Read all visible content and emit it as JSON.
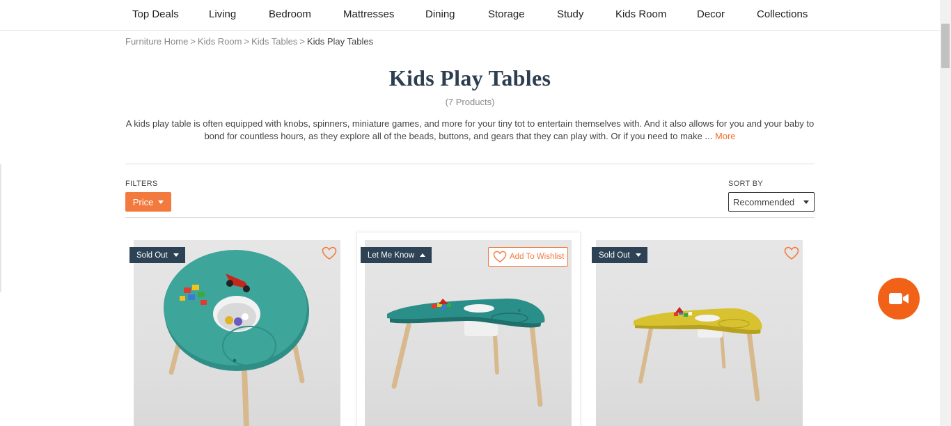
{
  "nav": {
    "items": [
      "Top Deals",
      "Living",
      "Bedroom",
      "Mattresses",
      "Dining",
      "Storage",
      "Study",
      "Kids Room",
      "Decor",
      "Collections"
    ]
  },
  "breadcrumb": {
    "items": [
      "Furniture Home",
      "Kids Room",
      "Kids Tables"
    ],
    "separator": ">",
    "current": "Kids Play Tables"
  },
  "page": {
    "title": "Kids Play Tables",
    "count": "(7 Products)",
    "description": "A kids play table is often equipped with knobs, spinners, miniature games, and more for your tiny tot to entertain themselves with. And it also allows for you and your baby to bond for countless hours, as they explore all of the beads, buttons, and gears that they can play with. Or if you need to make ...",
    "more_label": "More"
  },
  "filters": {
    "label": "FILTERS",
    "price_label": "Price"
  },
  "sort": {
    "label": "SORT BY",
    "selected": "Recommended"
  },
  "products": [
    {
      "badge": "Sold Out",
      "table_color": "#3ea59b",
      "wishlisted": false
    },
    {
      "badge": "Let Me Know",
      "table_color": "#2a8f89",
      "wishlist_label": "Add To Wishlist"
    },
    {
      "badge": "Sold Out",
      "table_color": "#d8c230",
      "wishlisted": false
    }
  ],
  "colors": {
    "accent": "#f37a3f",
    "badge_bg": "#2d4355",
    "title": "#2d3e50",
    "video_button": "#f26118"
  },
  "icons": {
    "heart": "heart-outline-icon",
    "video": "video-camera-icon"
  }
}
